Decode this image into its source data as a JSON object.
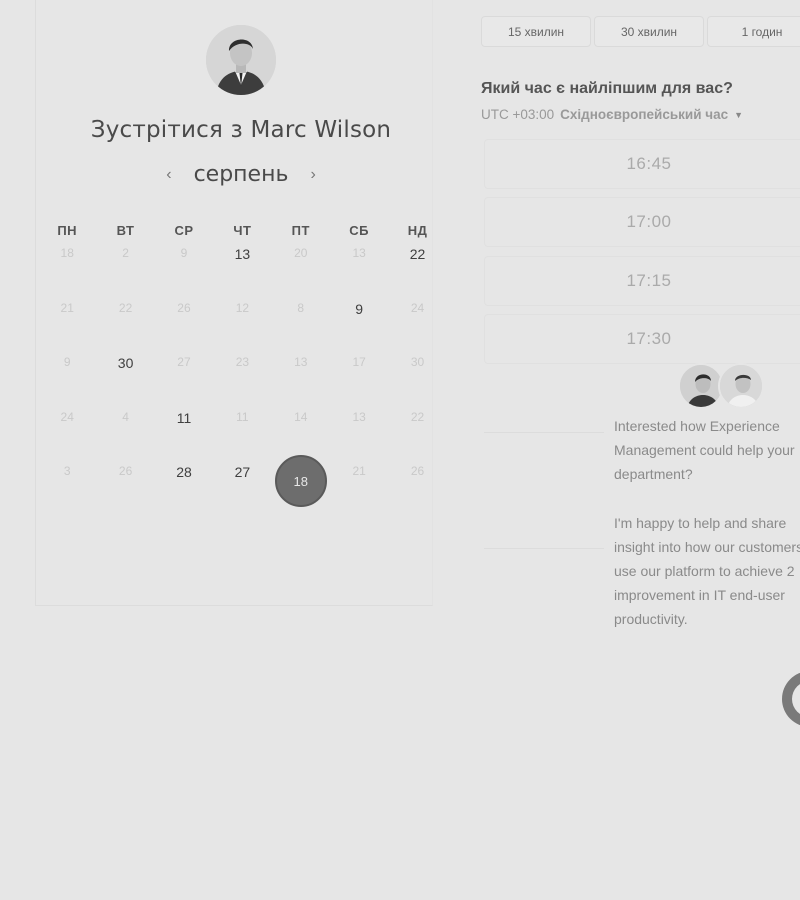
{
  "host": {
    "title_prefix": "Зустрітися з",
    "name": "Marc Wilson"
  },
  "calendar": {
    "month": "серпень",
    "prev_icon": "chevron-left-icon",
    "next_icon": "chevron-right-icon",
    "weekdays": [
      "ПН",
      "ВТ",
      "СР",
      "ЧТ",
      "ПТ",
      "СБ",
      "НД"
    ],
    "weeks": [
      [
        {
          "d": "18",
          "s": "muted"
        },
        {
          "d": "2",
          "s": "muted"
        },
        {
          "d": "9",
          "s": "muted"
        },
        {
          "d": "13",
          "s": "active"
        },
        {
          "d": "20",
          "s": "muted"
        },
        {
          "d": "13",
          "s": "muted"
        },
        {
          "d": "22",
          "s": "active"
        }
      ],
      [
        {
          "d": "21",
          "s": "muted"
        },
        {
          "d": "22",
          "s": "muted"
        },
        {
          "d": "26",
          "s": "muted"
        },
        {
          "d": "12",
          "s": "muted"
        },
        {
          "d": "8",
          "s": "muted"
        },
        {
          "d": "9",
          "s": "active"
        },
        {
          "d": "24",
          "s": "muted"
        }
      ],
      [
        {
          "d": "9",
          "s": "muted"
        },
        {
          "d": "30",
          "s": "active"
        },
        {
          "d": "27",
          "s": "muted"
        },
        {
          "d": "23",
          "s": "muted"
        },
        {
          "d": "13",
          "s": "muted"
        },
        {
          "d": "17",
          "s": "muted"
        },
        {
          "d": "30",
          "s": "muted"
        }
      ],
      [
        {
          "d": "24",
          "s": "muted"
        },
        {
          "d": "4",
          "s": "muted"
        },
        {
          "d": "11",
          "s": "active"
        },
        {
          "d": "11",
          "s": "muted"
        },
        {
          "d": "14",
          "s": "muted"
        },
        {
          "d": "13",
          "s": "muted"
        },
        {
          "d": "22",
          "s": "muted"
        }
      ],
      [
        {
          "d": "3",
          "s": "muted"
        },
        {
          "d": "26",
          "s": "muted"
        },
        {
          "d": "28",
          "s": "active"
        },
        {
          "d": "27",
          "s": "active"
        },
        {
          "d": "18",
          "s": "selected"
        },
        {
          "d": "21",
          "s": "muted"
        },
        {
          "d": "26",
          "s": "muted"
        }
      ]
    ]
  },
  "durations": [
    "15 хвилин",
    "30 хвилин",
    "1 годин"
  ],
  "question": "Який час є найліпшим для вас?",
  "timezone": {
    "offset": "UTC +03:00",
    "name": "Східноєвропейський час",
    "caret_icon": "caret-down-icon"
  },
  "slots": [
    "16:45",
    "17:00",
    "17:15",
    "17:30"
  ],
  "chat": {
    "message_1": "Interested how Experience Management could help your department?",
    "message_2": "I'm happy to help and share insight into how our customers use our platform to achieve 2 improvement in IT end-user productivity.",
    "launcher_icon": "chat-launcher-icon"
  },
  "colors": {
    "background": "#e6e6e6",
    "selected_day": "#6d6d6d"
  }
}
